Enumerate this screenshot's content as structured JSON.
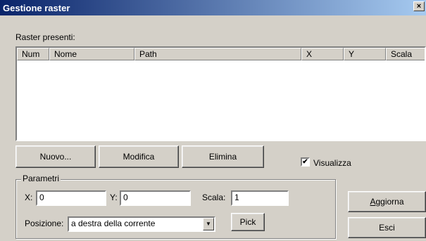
{
  "window": {
    "title": "Gestione raster",
    "close_glyph": "×"
  },
  "raster_list": {
    "label": "Raster presenti:",
    "columns": [
      "Num",
      "Nome",
      "Path",
      "X",
      "Y",
      "Scala"
    ],
    "rows": []
  },
  "buttons": {
    "nuovo": "Nuovo...",
    "modifica": "Modifica",
    "elimina": "Elimina",
    "aggiorna_accel": "A",
    "aggiorna_rest": "ggiorna",
    "esci": "Esci",
    "pick": "Pick"
  },
  "visualizza": {
    "label": "Visualizza",
    "checked": true,
    "check_glyph": "✔"
  },
  "parametri": {
    "title": "Parametri",
    "x_label": "X:",
    "x_value": "0",
    "y_label": "Y:",
    "y_value": "0",
    "scala_label": "Scala:",
    "scala_value": "1",
    "posizione_label": "Posizione:",
    "posizione_value": "a destra della corrente",
    "dropdown_glyph": "▼"
  },
  "icons": {
    "close": "close-icon",
    "dropdown": "chevron-down-icon",
    "check": "checkmark-icon"
  }
}
